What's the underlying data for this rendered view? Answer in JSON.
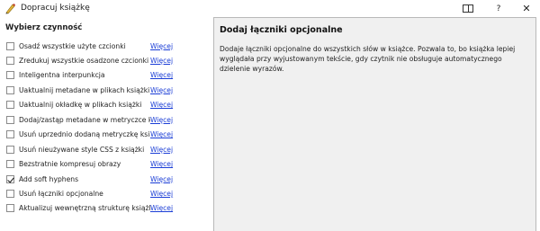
{
  "window": {
    "title": "Dopracuj książkę",
    "help_glyph": "?",
    "close_glyph": "✕"
  },
  "left_panel": {
    "section_title": "Wybierz czynność",
    "more_label": "Więcej",
    "actions": [
      {
        "label": "Osadź wszystkie użyte czcionki",
        "checked": false
      },
      {
        "label": "Zredukuj wszystkie osadzone czcionki",
        "checked": false
      },
      {
        "label": "Inteligentna interpunkcja",
        "checked": false
      },
      {
        "label": "Uaktualnij metadane w plikach książki",
        "checked": false
      },
      {
        "label": "Uaktualnij okładkę w plikach książki",
        "checked": false
      },
      {
        "label": "Dodaj/zastąp metadane w metryczce książki",
        "checked": false
      },
      {
        "label": "Usuń uprzednio dodaną metryczkę książki",
        "checked": false
      },
      {
        "label": "Usuń nieużywane style CSS z książki",
        "checked": false
      },
      {
        "label": "Bezstratnie kompresuj obrazy",
        "checked": false
      },
      {
        "label": "Add soft hyphens",
        "checked": true
      },
      {
        "label": "Usuń łączniki opcjonalne",
        "checked": false
      },
      {
        "label": "Aktualizuj wewnętrzną strukturę książki",
        "checked": false
      }
    ]
  },
  "right_panel": {
    "title": "Dodaj łączniki opcjonalne",
    "text": "Dodaje łączniki opcjonalne do wszystkich słów w książce. Pozwala to, bo książka lepiej wyglądała przy wyjustowanym tekście, gdy czytnik nie obsługuje automatycznego dzielenie wyrazów."
  },
  "colors": {
    "link": "#1a3dd6",
    "panel_bg": "#f0f0f0",
    "icon_accent": "#e0a020"
  }
}
